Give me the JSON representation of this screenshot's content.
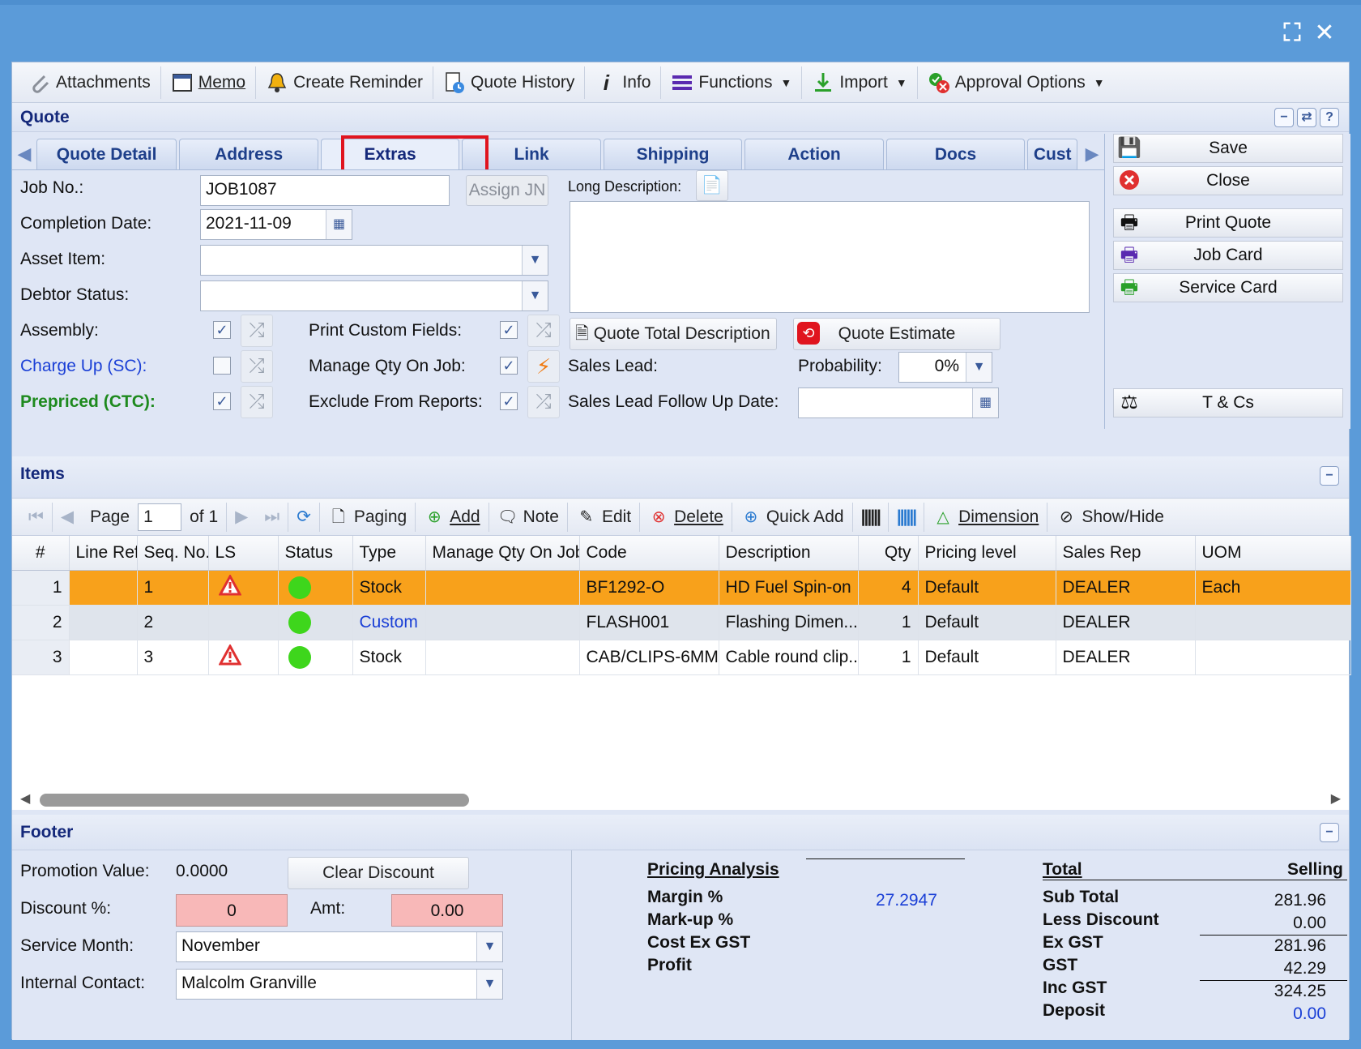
{
  "window": {
    "title": "Quote"
  },
  "toolbar": {
    "attachments": "Attachments",
    "memo": "Memo",
    "create_reminder": "Create Reminder",
    "quote_history": "Quote History",
    "info": "Info",
    "functions": "Functions",
    "import": "Import",
    "approval_options": "Approval Options"
  },
  "tabs": [
    "Quote Detail",
    "Address",
    "Extras",
    "Link",
    "Shipping",
    "Action",
    "Docs",
    "Cust"
  ],
  "form": {
    "job_no_label": "Job No.:",
    "job_no_value": "JOB1087",
    "assign_jn": "Assign JN",
    "completion_date_label": "Completion Date:",
    "completion_date_value": "2021-11-09",
    "asset_item_label": "Asset Item:",
    "asset_item_value": "",
    "debtor_status_label": "Debtor Status:",
    "debtor_status_value": "",
    "assembly_label": "Assembly:",
    "charge_up_label": "Charge Up (SC):",
    "prepriced_label": "Prepriced (CTC):",
    "print_custom_fields_label": "Print Custom Fields:",
    "manage_qty_label": "Manage Qty On Job:",
    "exclude_reports_label": "Exclude From Reports:",
    "long_description_label": "Long Description:",
    "long_description_value": "",
    "quote_total_description": "Quote Total Description",
    "quote_estimate": "Quote Estimate",
    "sales_lead_label": "Sales Lead:",
    "probability_label": "Probability:",
    "probability_value": "0%",
    "sales_lead_followup_label": "Sales Lead Follow Up Date:",
    "sales_lead_followup_value": ""
  },
  "side_buttons": {
    "save": "Save",
    "close": "Close",
    "print_quote": "Print Quote",
    "job_card": "Job Card",
    "service_card": "Service Card",
    "tcs": "T & Cs"
  },
  "items": {
    "title": "Items",
    "page_label": "Page",
    "page_value": "1",
    "of_label": "of 1",
    "paging": "Paging",
    "add": "Add",
    "note": "Note",
    "edit": "Edit",
    "delete": "Delete",
    "quick_add": "Quick Add",
    "dimension": "Dimension",
    "show_hide": "Show/Hide",
    "columns": [
      "#",
      "Line Ref.",
      "Seq. No.",
      "LS",
      "Status",
      "Type",
      "Manage Qty On Job",
      "Code",
      "Description",
      "Qty",
      "Pricing level",
      "Sales Rep",
      "UOM"
    ],
    "rows": [
      {
        "num": "1",
        "line_ref": "",
        "seq": "1",
        "ls_warn": true,
        "type": "Stock",
        "manage": "",
        "code": "BF1292-O",
        "desc": "HD Fuel Spin-on",
        "qty": "4",
        "pricing": "Default",
        "rep": "DEALER",
        "uom": "Each"
      },
      {
        "num": "2",
        "line_ref": "",
        "seq": "2",
        "ls_warn": false,
        "type": "Custom",
        "manage": "",
        "code": "FLASH001",
        "desc": "Flashing Dimen...",
        "qty": "1",
        "pricing": "Default",
        "rep": "DEALER",
        "uom": ""
      },
      {
        "num": "3",
        "line_ref": "",
        "seq": "3",
        "ls_warn": true,
        "type": "Stock",
        "manage": "",
        "code": "CAB/CLIPS-6MM",
        "desc": "Cable round clip...",
        "qty": "1",
        "pricing": "Default",
        "rep": "DEALER",
        "uom": ""
      }
    ]
  },
  "footer": {
    "title": "Footer",
    "promotion_label": "Promotion Value:",
    "promotion_value": "0.0000",
    "clear_discount": "Clear Discount",
    "discount_pct_label": "Discount %:",
    "discount_pct_value": "0",
    "amt_label": "Amt:",
    "amt_value": "0.00",
    "service_month_label": "Service Month:",
    "service_month_value": "November",
    "internal_contact_label": "Internal Contact:",
    "internal_contact_value": "Malcolm Granville",
    "pricing_analysis": "Pricing Analysis",
    "margin_label": "Margin %",
    "margin_value": "27.2947",
    "markup_label": "Mark-up %",
    "cost_label": "Cost Ex GST",
    "profit_label": "Profit",
    "total_label": "Total",
    "selling_label": "Selling",
    "sub_total_label": "Sub Total",
    "sub_total_value": "281.96",
    "less_discount_label": "Less Discount",
    "less_discount_value": "0.00",
    "ex_gst_label": "Ex GST",
    "ex_gst_value": "281.96",
    "gst_label": "GST",
    "gst_value": "42.29",
    "inc_gst_label": "Inc GST",
    "inc_gst_value": "324.25",
    "deposit_label": "Deposit",
    "deposit_value": "0.00"
  },
  "colors": {
    "titlebar": "#5b9bd9",
    "tab_text": "#1e3f8a",
    "selected_row": "#f8a11b",
    "status_ok": "#3ed61c",
    "highlight": "#e0141e",
    "link_blue": "#1a3fd6",
    "green_label": "#1e8a1e"
  }
}
